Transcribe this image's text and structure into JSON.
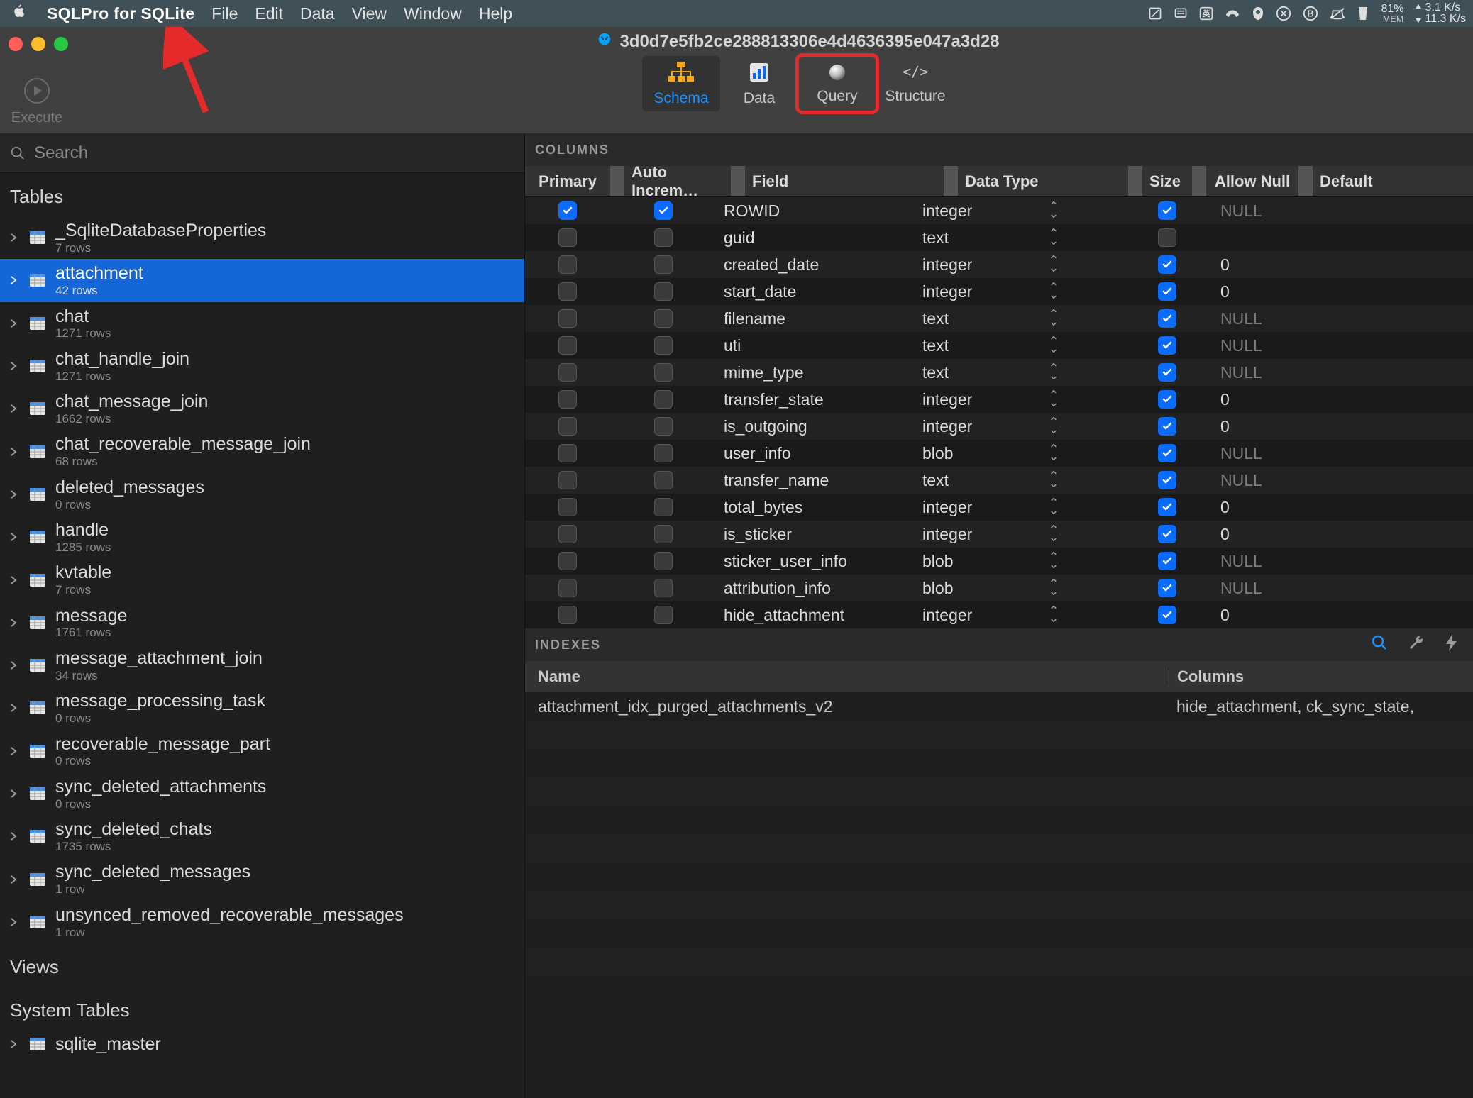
{
  "menubar": {
    "app_name": "SQLPro for SQLite",
    "items": [
      "File",
      "Edit",
      "Data",
      "View",
      "Window",
      "Help"
    ],
    "battery_pct": "81%",
    "battery_sub": "MEM",
    "net_up": "3.1 K/s",
    "net_down": "11.3 K/s"
  },
  "titlebar": {
    "execute_label": "Execute",
    "db_name": "3d0d7e5fb2ce288813306e4d4636395e047a3d28",
    "tabs": {
      "schema": "Schema",
      "data": "Data",
      "query": "Query",
      "structure": "Structure"
    }
  },
  "sidebar": {
    "search_placeholder": "Search",
    "sections": {
      "tables": "Tables",
      "views": "Views",
      "system_tables": "System Tables"
    },
    "tables": [
      {
        "name": "_SqliteDatabaseProperties",
        "rows": "7 rows"
      },
      {
        "name": "attachment",
        "rows": "42 rows",
        "selected": true
      },
      {
        "name": "chat",
        "rows": "1271 rows"
      },
      {
        "name": "chat_handle_join",
        "rows": "1271 rows"
      },
      {
        "name": "chat_message_join",
        "rows": "1662 rows"
      },
      {
        "name": "chat_recoverable_message_join",
        "rows": "68 rows"
      },
      {
        "name": "deleted_messages",
        "rows": "0 rows"
      },
      {
        "name": "handle",
        "rows": "1285 rows"
      },
      {
        "name": "kvtable",
        "rows": "7 rows"
      },
      {
        "name": "message",
        "rows": "1761 rows"
      },
      {
        "name": "message_attachment_join",
        "rows": "34 rows"
      },
      {
        "name": "message_processing_task",
        "rows": "0 rows"
      },
      {
        "name": "recoverable_message_part",
        "rows": "0 rows"
      },
      {
        "name": "sync_deleted_attachments",
        "rows": "0 rows"
      },
      {
        "name": "sync_deleted_chats",
        "rows": "1735 rows"
      },
      {
        "name": "sync_deleted_messages",
        "rows": "1 row"
      },
      {
        "name": "unsynced_removed_recoverable_messages",
        "rows": "1 row"
      }
    ],
    "system_tables": [
      {
        "name": "sqlite_master"
      }
    ]
  },
  "columns": {
    "heading": "COLUMNS",
    "headers": {
      "primary": "Primary",
      "auto": "Auto Increm…",
      "field": "Field",
      "type": "Data Type",
      "size": "Size",
      "null": "Allow Null",
      "default": "Default"
    },
    "rows": [
      {
        "primary": true,
        "auto": true,
        "field": "ROWID",
        "type": "integer",
        "allow_null": true,
        "def": "NULL"
      },
      {
        "primary": false,
        "auto": false,
        "field": "guid",
        "type": "text",
        "allow_null": false,
        "def": ""
      },
      {
        "primary": false,
        "auto": false,
        "field": "created_date",
        "type": "integer",
        "allow_null": true,
        "def": "0"
      },
      {
        "primary": false,
        "auto": false,
        "field": "start_date",
        "type": "integer",
        "allow_null": true,
        "def": "0"
      },
      {
        "primary": false,
        "auto": false,
        "field": "filename",
        "type": "text",
        "allow_null": true,
        "def": "NULL"
      },
      {
        "primary": false,
        "auto": false,
        "field": "uti",
        "type": "text",
        "allow_null": true,
        "def": "NULL"
      },
      {
        "primary": false,
        "auto": false,
        "field": "mime_type",
        "type": "text",
        "allow_null": true,
        "def": "NULL"
      },
      {
        "primary": false,
        "auto": false,
        "field": "transfer_state",
        "type": "integer",
        "allow_null": true,
        "def": "0"
      },
      {
        "primary": false,
        "auto": false,
        "field": "is_outgoing",
        "type": "integer",
        "allow_null": true,
        "def": "0"
      },
      {
        "primary": false,
        "auto": false,
        "field": "user_info",
        "type": "blob",
        "allow_null": true,
        "def": "NULL"
      },
      {
        "primary": false,
        "auto": false,
        "field": "transfer_name",
        "type": "text",
        "allow_null": true,
        "def": "NULL"
      },
      {
        "primary": false,
        "auto": false,
        "field": "total_bytes",
        "type": "integer",
        "allow_null": true,
        "def": "0"
      },
      {
        "primary": false,
        "auto": false,
        "field": "is_sticker",
        "type": "integer",
        "allow_null": true,
        "def": "0"
      },
      {
        "primary": false,
        "auto": false,
        "field": "sticker_user_info",
        "type": "blob",
        "allow_null": true,
        "def": "NULL"
      },
      {
        "primary": false,
        "auto": false,
        "field": "attribution_info",
        "type": "blob",
        "allow_null": true,
        "def": "NULL"
      },
      {
        "primary": false,
        "auto": false,
        "field": "hide_attachment",
        "type": "integer",
        "allow_null": true,
        "def": "0"
      }
    ]
  },
  "indexes": {
    "heading": "INDEXES",
    "headers": {
      "name": "Name",
      "columns": "Columns"
    },
    "rows": [
      {
        "name": "attachment_idx_purged_attachments_v2",
        "columns": "hide_attachment, ck_sync_state,"
      }
    ],
    "empty_rows": 9
  }
}
